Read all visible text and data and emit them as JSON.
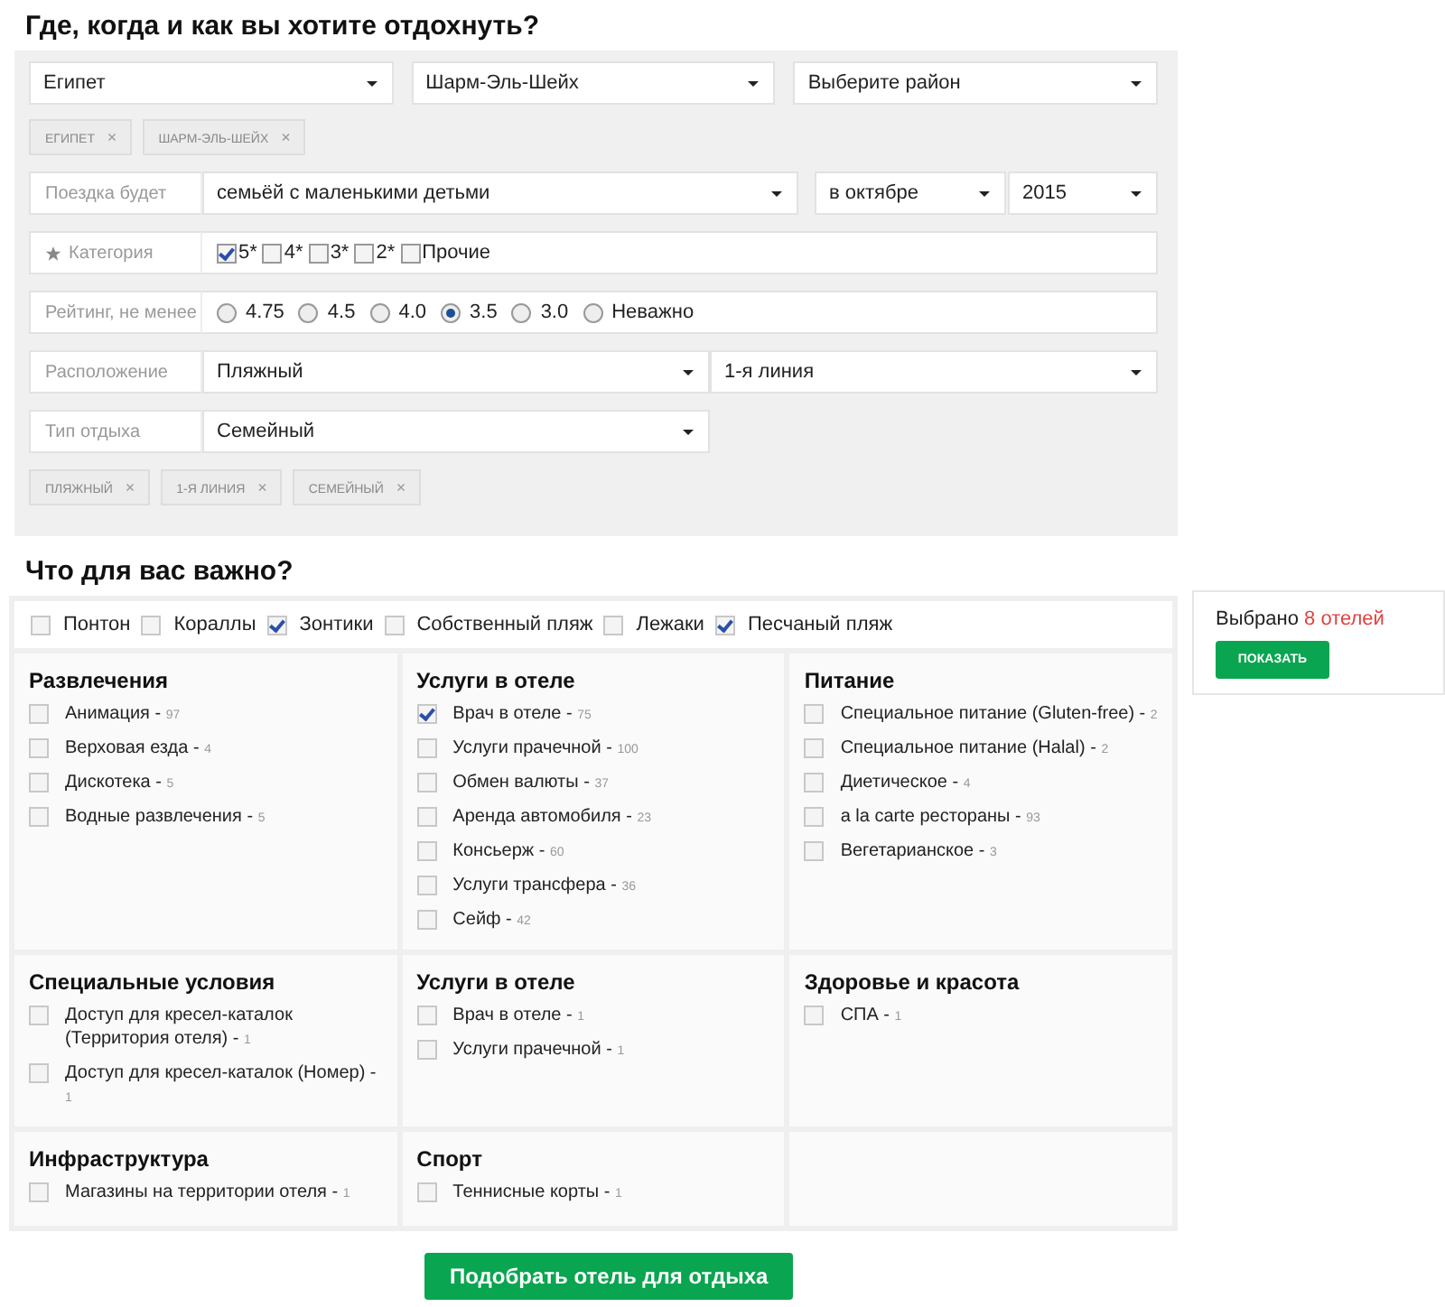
{
  "heading": "Где, когда и как вы хотите отдохнуть?",
  "destination_selects": [
    {
      "value": "Египет"
    },
    {
      "value": "Шарм-Эль-Шейх"
    },
    {
      "value": "Выберите район"
    }
  ],
  "destination_tags": [
    {
      "label": "ЕГИПЕТ",
      "remove": "×"
    },
    {
      "label": "ШАРМ-ЭЛЬ-ШЕЙХ",
      "remove": "×"
    }
  ],
  "filters": [
    {
      "kind": "trip",
      "label": "Поездка будет",
      "selects": [
        {
          "value": "семьёй с маленькими детьми"
        },
        {
          "value": "в октябре"
        },
        {
          "value": "2015"
        }
      ]
    },
    {
      "kind": "checks",
      "label": "Категория",
      "options": [
        {
          "label": "5*",
          "checked": true
        },
        {
          "label": "4*",
          "checked": false
        },
        {
          "label": "3*",
          "checked": false
        },
        {
          "label": "2*",
          "checked": false
        },
        {
          "label": "Прочие",
          "checked": false
        }
      ]
    },
    {
      "kind": "radios",
      "label": "Рейтинг, не менее",
      "options": [
        {
          "label": "4.75",
          "selected": false
        },
        {
          "label": "4.5",
          "selected": false
        },
        {
          "label": "4.0",
          "selected": false
        },
        {
          "label": "3.5",
          "selected": true
        },
        {
          "label": "3.0",
          "selected": false
        },
        {
          "label": "Неважно",
          "selected": false
        }
      ]
    },
    {
      "kind": "pair",
      "label": "Расположение",
      "selects": [
        {
          "value": "Пляжный"
        },
        {
          "value": "1-я линия"
        }
      ]
    },
    {
      "kind": "single",
      "label": "Тип отдыха",
      "selects": [
        {
          "value": "Семейный"
        }
      ]
    }
  ],
  "filter_tags": [
    {
      "label": "ПЛЯЖНЫЙ",
      "remove": "×"
    },
    {
      "label": "1-Я ЛИНИЯ",
      "remove": "×"
    },
    {
      "label": "СЕМЕЙНЫЙ",
      "remove": "×"
    }
  ],
  "subheading": "Что для вас важно?",
  "beach_options": [
    {
      "label": "Понтон",
      "checked": false
    },
    {
      "label": "Кораллы",
      "checked": false
    },
    {
      "label": "Зонтики",
      "checked": true
    },
    {
      "label": "Собственный пляж",
      "checked": false
    },
    {
      "label": "Лежаки",
      "checked": false
    },
    {
      "label": "Песчаный пляж",
      "checked": true
    }
  ],
  "groups": [
    {
      "title": "Развлечения",
      "items": [
        {
          "label": "Анимация -",
          "count": "97",
          "checked": false
        },
        {
          "label": "Верховая езда -",
          "count": "4",
          "checked": false
        },
        {
          "label": "Дискотека -",
          "count": "5",
          "checked": false
        },
        {
          "label": "Водные развлечения -",
          "count": "5",
          "checked": false
        }
      ]
    },
    {
      "title": "Услуги в отеле",
      "items": [
        {
          "label": "Врач в отеле -",
          "count": "75",
          "checked": true
        },
        {
          "label": "Услуги прачечной -",
          "count": "100",
          "checked": false
        },
        {
          "label": "Обмен валюты -",
          "count": "37",
          "checked": false
        },
        {
          "label": "Аренда автомобиля -",
          "count": "23",
          "checked": false
        },
        {
          "label": "Консьерж -",
          "count": "60",
          "checked": false
        },
        {
          "label": "Услуги трансфера -",
          "count": "36",
          "checked": false
        },
        {
          "label": "Сейф -",
          "count": "42",
          "checked": false
        }
      ]
    },
    {
      "title": "Питание",
      "items": [
        {
          "label": "Специальное питание (Gluten-free) -",
          "count": "2",
          "checked": false
        },
        {
          "label": "Специальное питание (Halal) -",
          "count": "2",
          "checked": false
        },
        {
          "label": "Диетическое -",
          "count": "4",
          "checked": false
        },
        {
          "label": "a la carte рестораны -",
          "count": "93",
          "checked": false
        },
        {
          "label": "Вегетарианское -",
          "count": "3",
          "checked": false
        }
      ]
    },
    {
      "title": "Специальные условия",
      "items": [
        {
          "label": "Доступ для кресел-каталок (Территория отеля) -",
          "count": "1",
          "checked": false
        },
        {
          "label": "Доступ для кресел-каталок (Номер) -",
          "count": "1",
          "checked": false
        }
      ]
    },
    {
      "title": "Услуги в отеле",
      "items": [
        {
          "label": "Врач в отеле -",
          "count": "1",
          "checked": false
        },
        {
          "label": "Услуги прачечной -",
          "count": "1",
          "checked": false
        }
      ]
    },
    {
      "title": "Здоровье и красота",
      "items": [
        {
          "label": "СПА -",
          "count": "1",
          "checked": false
        }
      ]
    },
    {
      "title": "Инфраструктура",
      "items": [
        {
          "label": "Магазины на территории отеля -",
          "count": "1",
          "checked": false
        }
      ]
    },
    {
      "title": "Спорт",
      "items": [
        {
          "label": "Теннисные корты -",
          "count": "1",
          "checked": false
        }
      ]
    }
  ],
  "summary": {
    "label": "Выбрано",
    "count": "8 отелей",
    "button": "ПОКАЗАТЬ"
  },
  "submit": "Подобрать отель для отдыха"
}
